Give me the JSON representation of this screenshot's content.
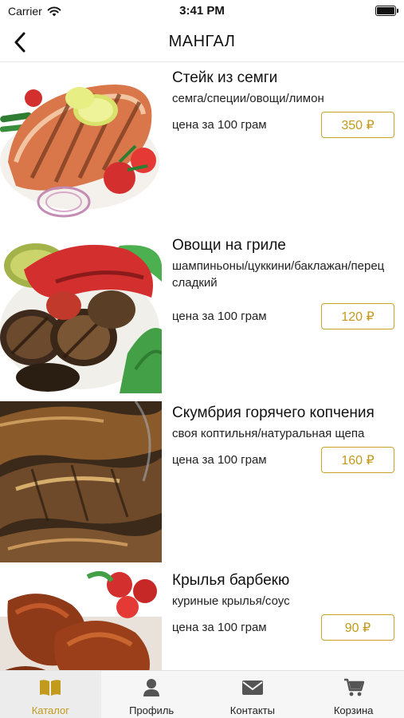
{
  "status": {
    "carrier": "Carrier",
    "time": "3:41 PM"
  },
  "nav": {
    "title": "МАНГАЛ"
  },
  "items": [
    {
      "name": "Стейк из семги",
      "desc": "семга/специи/овощи/лимон",
      "price_label": "цена за 100 грам",
      "price": "350 ₽"
    },
    {
      "name": "Овощи на гриле",
      "desc": "шампиньоны/цуккини/баклажан/перец сладкий",
      "price_label": "цена за 100 грам",
      "price": "120 ₽"
    },
    {
      "name": "Скумбрия горячего копчения",
      "desc": "своя коптильня/натуральная щепа",
      "price_label": "цена за 100 грам",
      "price": "160 ₽"
    },
    {
      "name": "Крылья барбекю",
      "desc": "куриные крылья/соус",
      "price_label": "цена за 100 грам",
      "price": "90 ₽"
    }
  ],
  "tabs": [
    {
      "label": "Каталог",
      "icon": "book-icon",
      "active": true
    },
    {
      "label": "Профиль",
      "icon": "person-icon",
      "active": false
    },
    {
      "label": "Контакты",
      "icon": "envelope-icon",
      "active": false
    },
    {
      "label": "Корзина",
      "icon": "cart-icon",
      "active": false
    }
  ],
  "colors": {
    "accent": "#c29a1c"
  }
}
